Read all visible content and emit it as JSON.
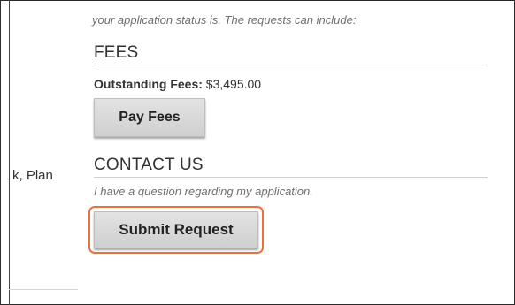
{
  "left_panel": {
    "partial_text": "k, Plan"
  },
  "intro_text": "your application status is. The requests can include:",
  "fees": {
    "title": "FEES",
    "outstanding_label": "Outstanding Fees:",
    "outstanding_value": "$3,495.00",
    "pay_button": "Pay Fees"
  },
  "contact": {
    "title": "CONTACT US",
    "question": "I have a question regarding my application.",
    "submit_button": "Submit Request"
  },
  "colors": {
    "highlight_outline": "#e9713e"
  }
}
